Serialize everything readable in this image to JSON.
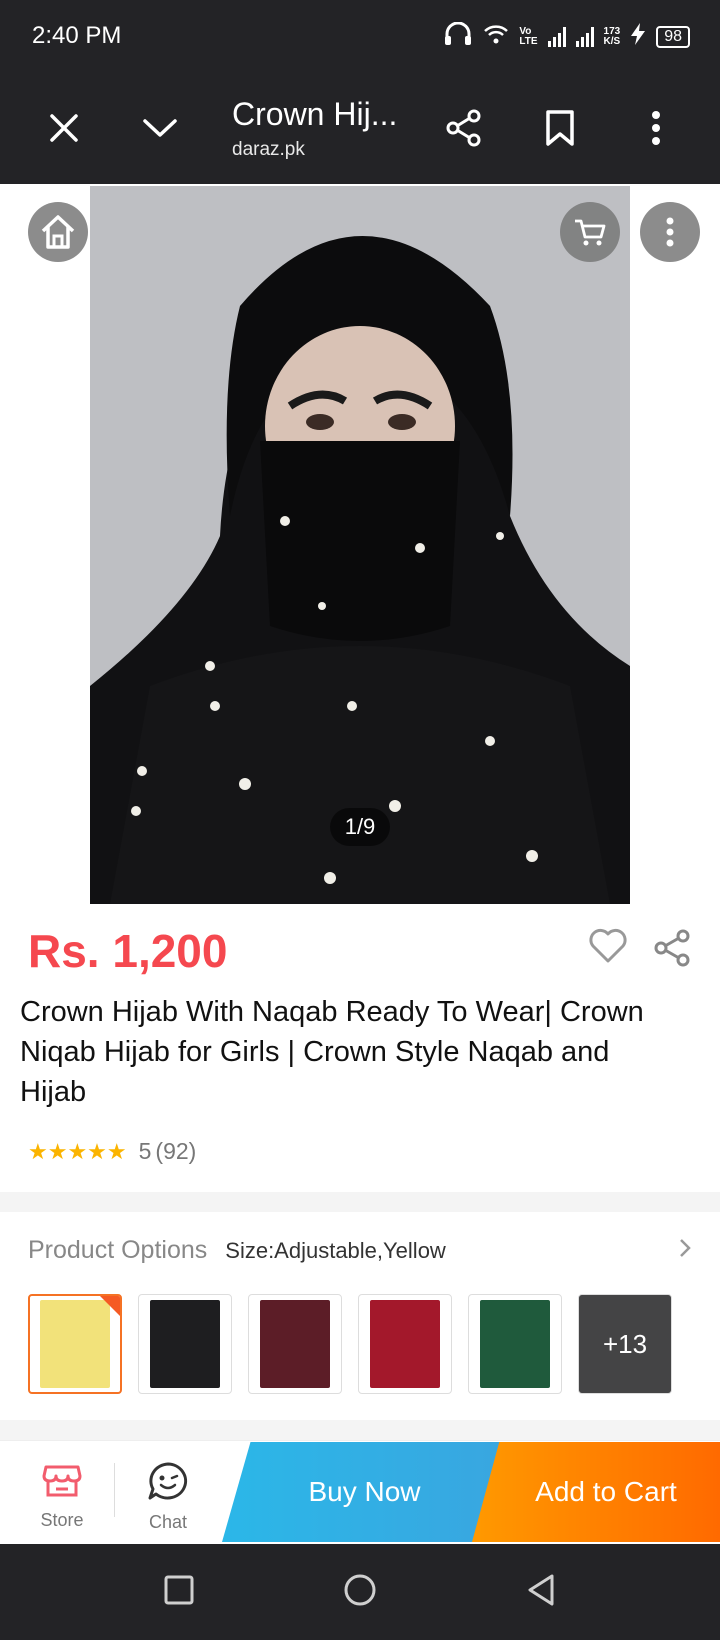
{
  "status_bar": {
    "time": "2:40 PM",
    "speed_top": "173",
    "speed_bottom": "K/S",
    "battery": "98",
    "volte_top": "Vo",
    "volte_bottom": "LTE"
  },
  "app_bar": {
    "title": "Crown Hij...",
    "domain": "daraz.pk",
    "icons": [
      "close-icon",
      "chevron-down-icon",
      "share-icon",
      "bookmark-icon",
      "more-vert-icon"
    ]
  },
  "gallery": {
    "page_indicator": "1/9",
    "overlay_icons": [
      "home-icon",
      "cart-icon",
      "more-vert-icon"
    ]
  },
  "product": {
    "price": "Rs. 1,200",
    "title": "Crown Hijab With Naqab Ready To Wear| Crown Niqab Hijab for Girls | Crown Style Naqab and Hijab",
    "rating_value": "5",
    "rating_count": "(92)",
    "stars": "★★★★★"
  },
  "options": {
    "label": "Product Options",
    "value": "Size:Adjustable,Yellow",
    "thumbnails": [
      {
        "color": "#f2e27a",
        "selected": true
      },
      {
        "color": "#1e1e20",
        "selected": false
      },
      {
        "color": "#5c1d27",
        "selected": false
      },
      {
        "color": "#a3182b",
        "selected": false
      },
      {
        "color": "#1f5a3c",
        "selected": false
      },
      {
        "color": "#2a2a2d",
        "selected": false
      }
    ],
    "more_label": "+13"
  },
  "bottom_bar": {
    "store_label": "Store",
    "chat_label": "Chat",
    "buy_now": "Buy Now",
    "add_to_cart": "Add to Cart"
  },
  "colors": {
    "price": "#f5484f",
    "accent_orange": "#f57224",
    "buy_now": "#2bb7e8",
    "add_to_cart": "#ff7a00",
    "store_icon": "#f25c6d"
  }
}
